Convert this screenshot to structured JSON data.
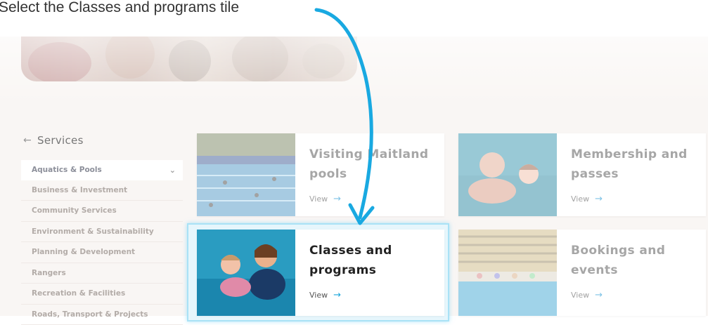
{
  "instruction": "Select the Classes and programs tile",
  "sidebar": {
    "back_label": "Services",
    "items": [
      {
        "label": "Aquatics & Pools"
      },
      {
        "label": "Business & Investment"
      },
      {
        "label": "Community Services"
      },
      {
        "label": "Environment & Sustainability"
      },
      {
        "label": "Planning & Development"
      },
      {
        "label": "Rangers"
      },
      {
        "label": "Recreation & Facilities"
      },
      {
        "label": "Roads, Transport & Projects"
      }
    ]
  },
  "tiles": [
    {
      "title_line1": "Visiting Maitland",
      "title_line2": "pools",
      "view": "View"
    },
    {
      "title_line1": "Membership and",
      "title_line2": "passes",
      "view": "View"
    },
    {
      "title_line1": "Classes and",
      "title_line2": "programs",
      "view": "View"
    },
    {
      "title_line1": "Bookings and",
      "title_line2": "events",
      "view": "View"
    }
  ],
  "icons": {
    "back": "arrow-left-icon",
    "chevron": "chevron-down-icon",
    "view": "arrow-right-icon"
  },
  "colors": {
    "annotation_arrow": "#19a9e1",
    "highlight_border": "#a9e2f6"
  }
}
